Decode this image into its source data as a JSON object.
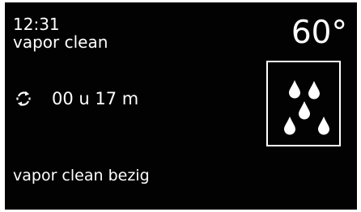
{
  "header": {
    "time": "12:31",
    "program": "vapor clean",
    "temperature": "60°"
  },
  "timer": {
    "icon": "cycle-arrows-icon",
    "remaining": "00 u 17 m"
  },
  "program_icon": {
    "icon": "steam-droplets-icon",
    "selected": true
  },
  "status": {
    "message": "vapor clean bezig"
  },
  "colors": {
    "background": "#020202",
    "foreground": "#ffffff"
  }
}
